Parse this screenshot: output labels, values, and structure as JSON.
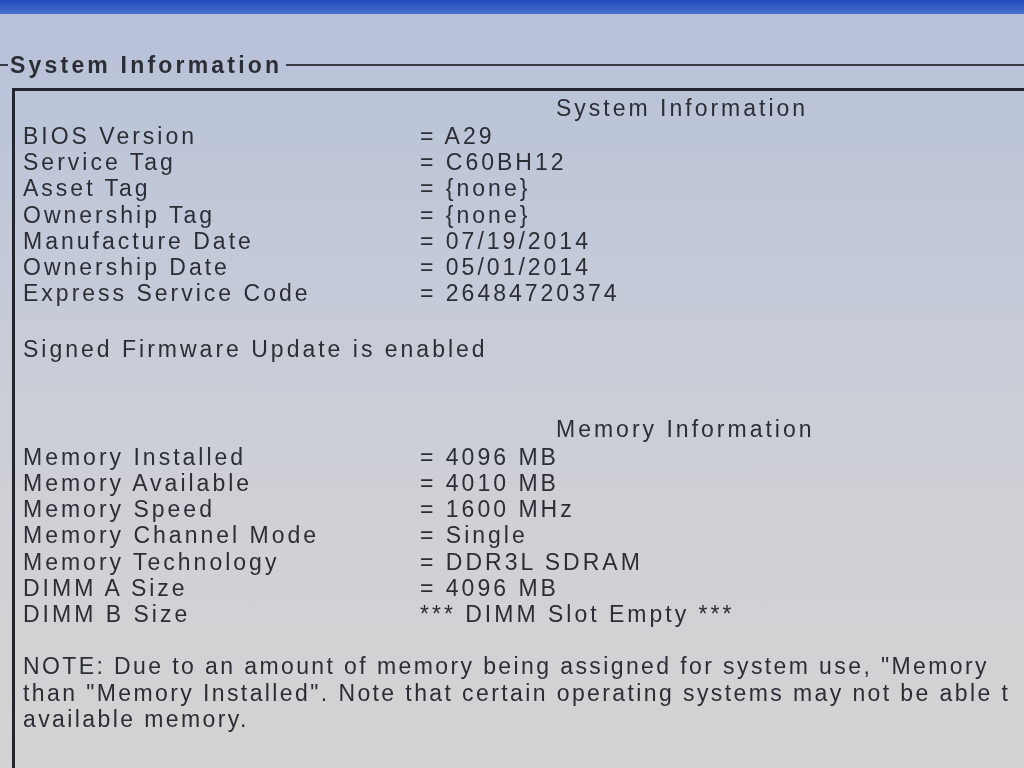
{
  "window": {
    "title": "System Information"
  },
  "panel": {
    "sections": [
      {
        "heading": "System Information",
        "rows": [
          {
            "label": "BIOS Version",
            "value": "= A29"
          },
          {
            "label": "Service Tag",
            "value": "= C60BH12"
          },
          {
            "label": "Asset Tag",
            "value": "= {none}"
          },
          {
            "label": "Ownership Tag",
            "value": "= {none}"
          },
          {
            "label": "Manufacture Date",
            "value": "= 07/19/2014"
          },
          {
            "label": "Ownership Date",
            "value": "= 05/01/2014"
          },
          {
            "label": "Express Service Code",
            "value": "= 26484720374"
          }
        ],
        "message": "Signed Firmware Update is enabled"
      },
      {
        "heading": "Memory Information",
        "rows": [
          {
            "label": "Memory Installed",
            "value": "= 4096 MB"
          },
          {
            "label": "Memory Available",
            "value": "= 4010 MB"
          },
          {
            "label": "Memory Speed",
            "value": "= 1600 MHz"
          },
          {
            "label": "Memory Channel Mode",
            "value": "= Single"
          },
          {
            "label": "Memory Technology",
            "value": "= DDR3L SDRAM"
          },
          {
            "label": "DIMM A Size",
            "value": "= 4096 MB"
          },
          {
            "label": "DIMM B Size",
            "value": "*** DIMM Slot Empty ***"
          }
        ],
        "note_lines": [
          "NOTE: Due to an amount of memory being assigned for system use, \"Memory",
          "than \"Memory Installed\". Note that certain operating systems may not be able t",
          "available memory."
        ]
      }
    ]
  }
}
